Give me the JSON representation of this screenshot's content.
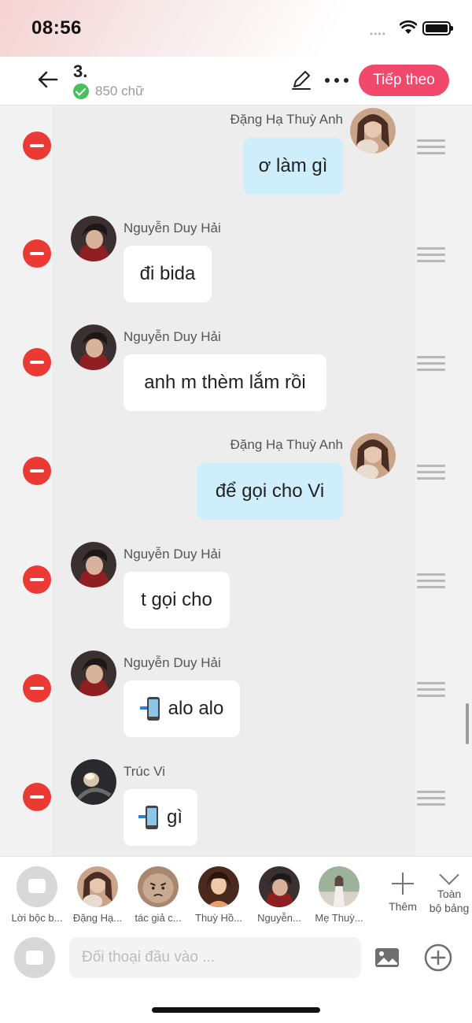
{
  "status": {
    "time": "08:56",
    "signal": "••••"
  },
  "header": {
    "chapter": "3.",
    "word_count": "850 chữ",
    "next_label": "Tiếp theo",
    "accent": "#f2486b"
  },
  "messages": [
    {
      "speaker": "Đặng Hạ Thuỳ Anh",
      "text": "ơ làm gì",
      "side": "right",
      "icon": null
    },
    {
      "speaker": "Nguyễn Duy Hải",
      "text": "đi bida",
      "side": "left",
      "icon": null
    },
    {
      "speaker": "Nguyễn Duy Hải",
      "text": "anh m thèm lắm rồi",
      "side": "left",
      "icon": null
    },
    {
      "speaker": "Đặng Hạ Thuỳ Anh",
      "text": "để gọi cho Vi",
      "side": "right",
      "icon": null
    },
    {
      "speaker": "Nguyễn Duy Hải",
      "text": "t gọi cho",
      "side": "left",
      "icon": null
    },
    {
      "speaker": "Nguyễn Duy Hải",
      "text": "alo alo",
      "side": "left",
      "icon": "phone-call-icon"
    },
    {
      "speaker": "Trúc Vi",
      "text": "gì",
      "side": "left",
      "icon": "phone-call-icon"
    }
  ],
  "characters": [
    {
      "label": "Lời bộc b..."
    },
    {
      "label": "Đặng Hạ..."
    },
    {
      "label": "tác giả c..."
    },
    {
      "label": "Thuỳ Hồ..."
    },
    {
      "label": "Nguyễn..."
    },
    {
      "label": "Mẹ Thuỳ..."
    }
  ],
  "toolbar": {
    "add_label": "Thêm",
    "board_label": "Toàn\nbộ bảng"
  },
  "input": {
    "placeholder": "Đối thoại đầu vào ...",
    "value": ""
  },
  "colors": {
    "bubble_me": "#cdeefa",
    "bubble_other": "#ffffff",
    "delete": "#ea3a33"
  }
}
